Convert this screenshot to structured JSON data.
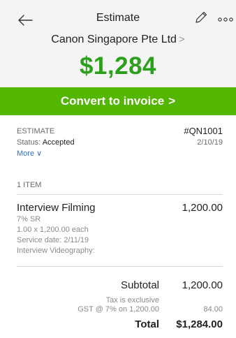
{
  "header": {
    "title": "Estimate",
    "customer": "Canon Singapore Pte Ltd",
    "customer_chevron": ">",
    "amount": "$1,284",
    "icons": {
      "back": "arrow-left-icon",
      "edit": "pencil-icon",
      "more": "more-horizontal-icon"
    }
  },
  "action": {
    "convert_label": "Convert to invoice",
    "convert_chevron": ">"
  },
  "meta": {
    "type_label": "ESTIMATE",
    "status_label": "Status:",
    "status_value": "Accepted",
    "more_label": "More",
    "more_chevron": "∨",
    "number": "#QN1001",
    "date": "2/10/19"
  },
  "items": {
    "count_label": "1 ITEM",
    "list": [
      {
        "name": "Interview Filming",
        "amount": "1,200.00",
        "tax_code": "7% SR",
        "qty_line": "1.00 x 1,200.00 each",
        "service_date": "Service date: 2/11/19",
        "description": "Interview Videography:"
      }
    ]
  },
  "totals": {
    "subtotal_label": "Subtotal",
    "subtotal_value": "1,200.00",
    "tax_note": "Tax is exclusive",
    "gst_label": "GST @ 7% on 1,200.00",
    "gst_value": "84.00",
    "total_label": "Total",
    "total_value": "$1,284.00"
  },
  "colors": {
    "accent_green": "#2ca01c",
    "button_green": "#53b700",
    "link_blue": "#3b6fc8"
  }
}
